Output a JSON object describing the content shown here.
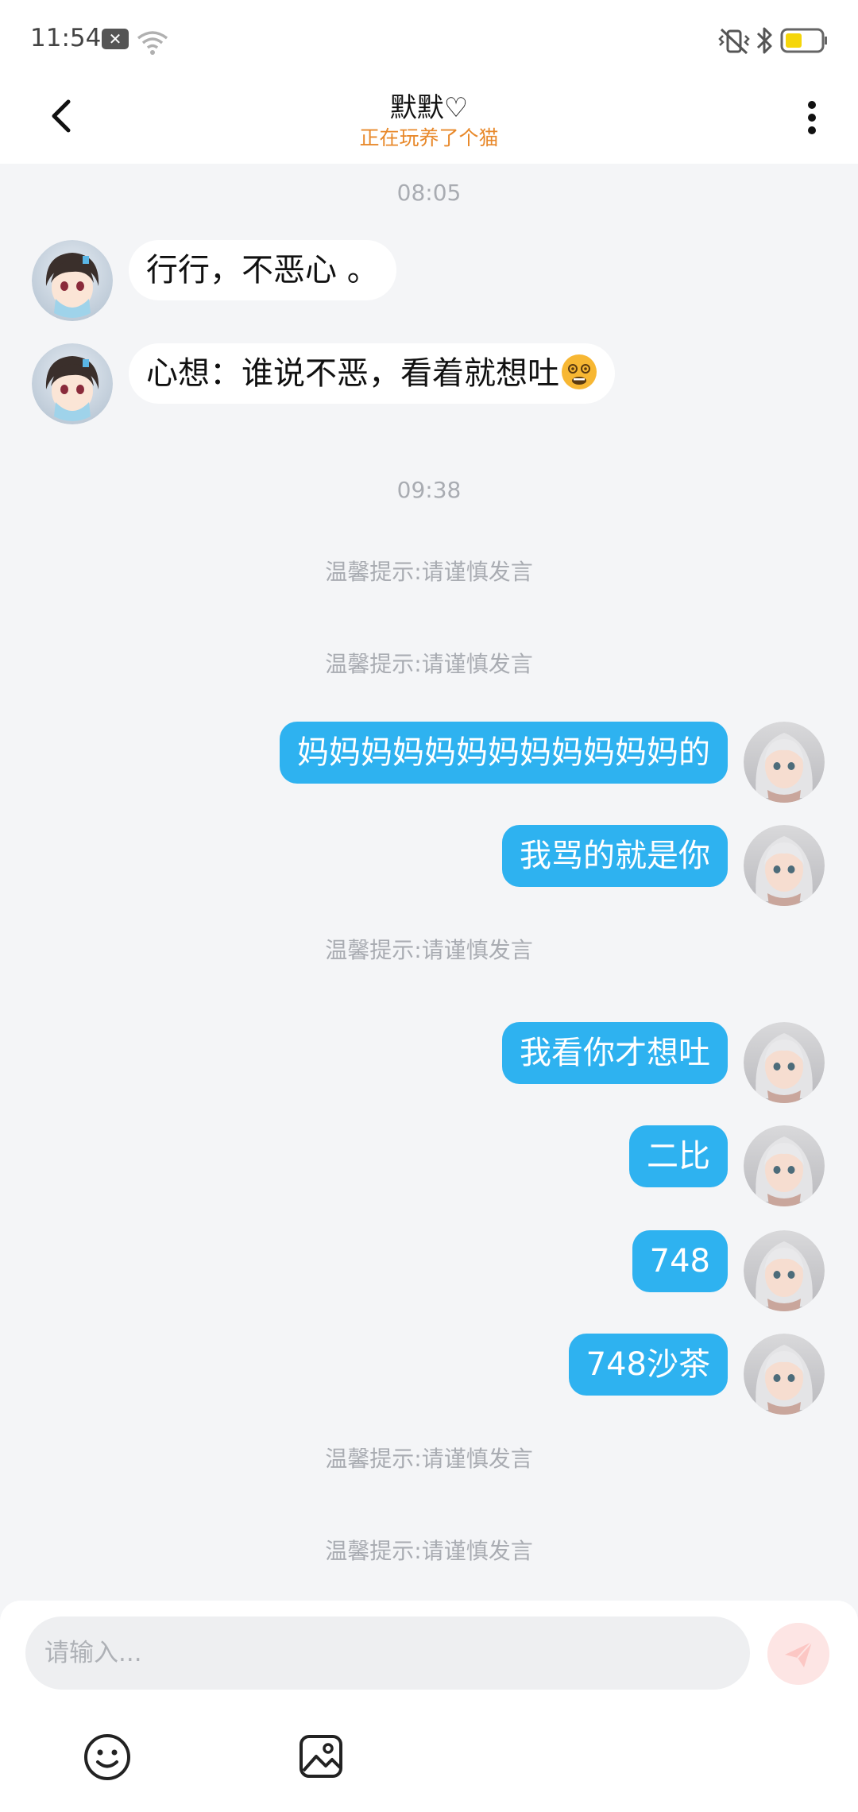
{
  "status_bar": {
    "time": "11:54"
  },
  "header": {
    "title": "默默♡",
    "subtitle": "正在玩养了个猫"
  },
  "messages": {
    "time1": "08:05",
    "in1": "行行，不恶心 。",
    "in2": "心想：谁说不恶，看着就想吐",
    "time2": "09:38",
    "tip1": "温馨提示:请谨慎发言",
    "tip2": "温馨提示:请谨慎发言",
    "out1": "妈妈妈妈妈妈妈妈妈妈妈妈的",
    "out2": "我骂的就是你",
    "tip3": "温馨提示:请谨慎发言",
    "out3": "我看你才想吐",
    "out4": "二比",
    "out5": "748",
    "out6": "748沙茶",
    "tip4": "温馨提示:请谨慎发言",
    "tip5": "温馨提示:请谨慎发言"
  },
  "composer": {
    "placeholder": "请输入..."
  },
  "colors": {
    "accent": "#2eb2f0",
    "subtitle": "#e8892b",
    "send": "#fde5e4",
    "battery": "#f5d60a"
  },
  "icons": [
    "back-icon",
    "more-icon",
    "smile-icon",
    "image-icon",
    "send-icon",
    "wifi-icon",
    "bluetooth-icon",
    "battery-icon",
    "vibrate-icon"
  ]
}
